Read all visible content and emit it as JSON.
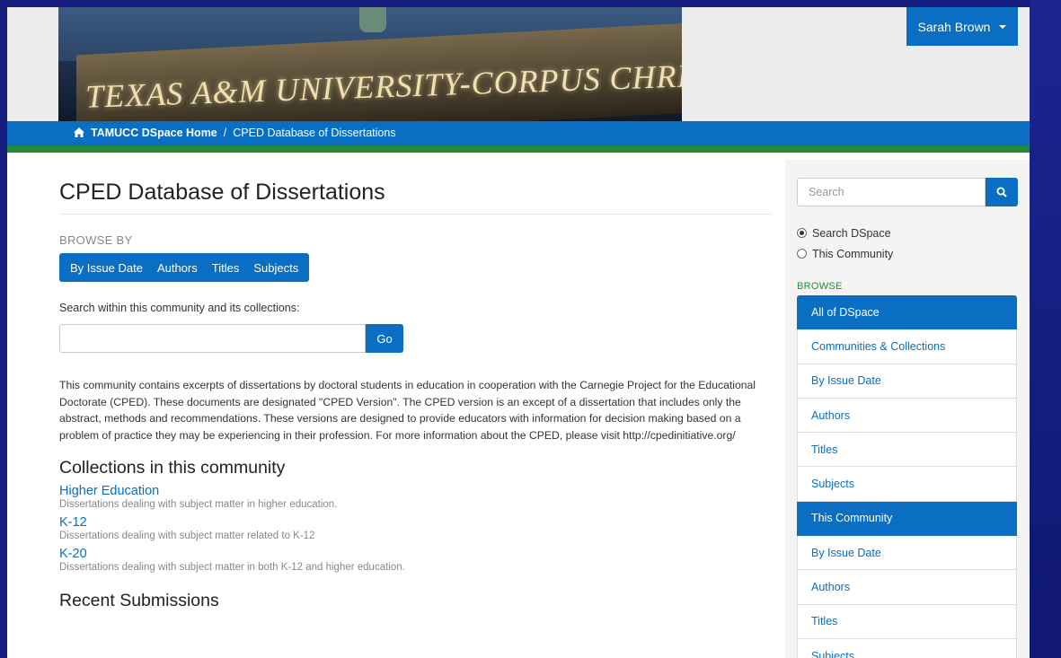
{
  "header": {
    "banner_text": "TEXAS A&M UNIVERSITY-CORPUS CHRISTI",
    "user_label": "Sarah Brown"
  },
  "breadcrumb": {
    "home": "TAMUCC DSpace Home",
    "separator": "/",
    "current": "CPED Database of Dissertations"
  },
  "main": {
    "title": "CPED Database of Dissertations",
    "browse_by_label": "BROWSE BY",
    "browse_buttons": [
      "By Issue Date",
      "Authors",
      "Titles",
      "Subjects"
    ],
    "search_label": "Search within this community and its collections:",
    "search_value": "",
    "go_label": "Go",
    "intro": "This community contains excerpts of dissertations by doctoral students in education in cooperation with the Carnegie Project for the Educational Doctorate (CPED). These documents are designated \"CPED Version\". The CPED version is an except of a dissertation that includes only the abstract, methods and recommendations. These versions are designed to provide educators with information for decision making based on a problem of practice they may be experiencing in their profession.   For more information about the CPED, please visit http://cpedinitiative.org/",
    "collections_heading": "Collections in this community",
    "collections": [
      {
        "name": "Higher Education",
        "desc": "Dissertations dealing with subject matter in higher education."
      },
      {
        "name": "K-12",
        "desc": "Dissertations dealing with subject matter related to K-12"
      },
      {
        "name": "K-20",
        "desc": "Dissertations dealing with subject matter in both K-12 and higher education."
      }
    ],
    "recent_heading": "Recent Submissions"
  },
  "sidebar": {
    "search_placeholder": "Search",
    "scope_options": [
      {
        "label": "Search DSpace",
        "selected": true
      },
      {
        "label": "This Community",
        "selected": false
      }
    ],
    "browse_label": "BROWSE",
    "nav": [
      {
        "label": "All of DSpace",
        "header": true
      },
      {
        "label": "Communities & Collections",
        "header": false
      },
      {
        "label": "By Issue Date",
        "header": false
      },
      {
        "label": "Authors",
        "header": false
      },
      {
        "label": "Titles",
        "header": false
      },
      {
        "label": "Subjects",
        "header": false
      },
      {
        "label": "This Community",
        "header": true
      },
      {
        "label": "By Issue Date",
        "header": false
      },
      {
        "label": "Authors",
        "header": false
      },
      {
        "label": "Titles",
        "header": false
      },
      {
        "label": "Subjects",
        "header": false
      }
    ]
  },
  "colors": {
    "primary": "#0a6ec2",
    "accent_green": "#238b3b",
    "desktop_bg": "#141c7e"
  }
}
